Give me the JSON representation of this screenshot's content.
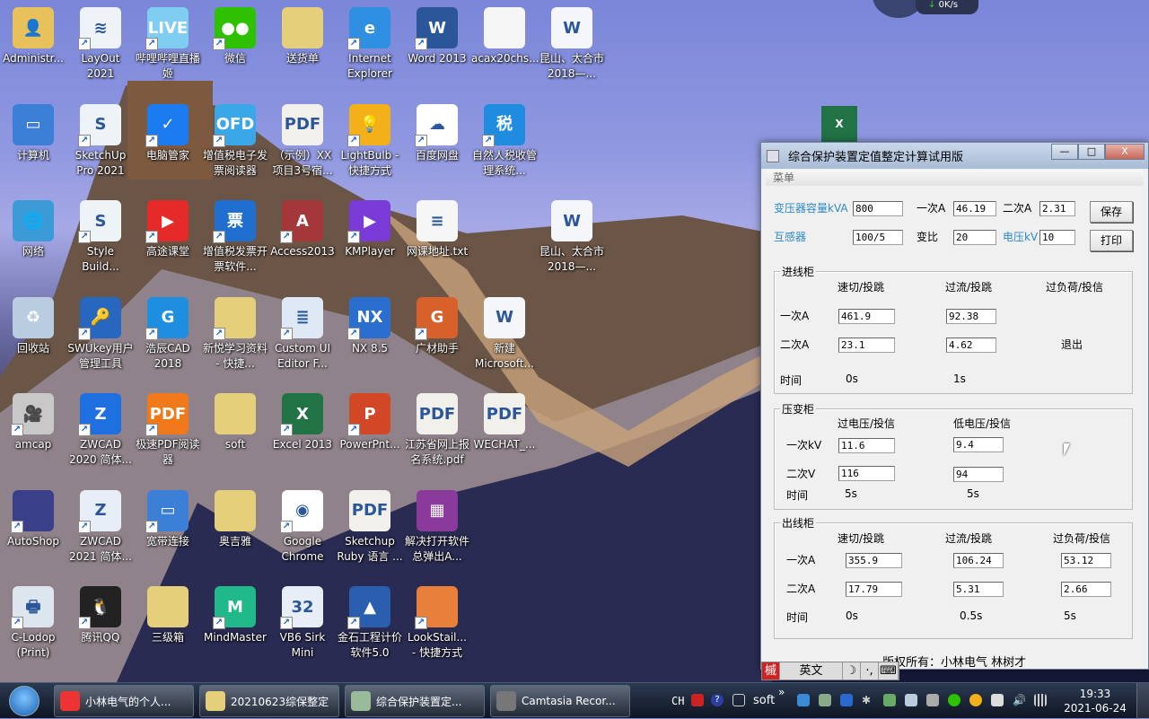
{
  "desktop": {
    "icons": [
      {
        "label": "Administr...",
        "col": 0,
        "row": 0,
        "color": "#e8c15a",
        "glyph": "👤",
        "shortcut": false
      },
      {
        "label": "LayOut 2021",
        "col": 1,
        "row": 0,
        "color": "#eef3f8",
        "glyph": "≋",
        "shortcut": true
      },
      {
        "label": "哔哩哔哩直播姬",
        "col": 2,
        "row": 0,
        "color": "#7fcdf0",
        "glyph": "LIVE",
        "shortcut": true
      },
      {
        "label": "微信",
        "col": 3,
        "row": 0,
        "color": "#2dc100",
        "glyph": "●●",
        "shortcut": true
      },
      {
        "label": "送货单",
        "col": 4,
        "row": 0,
        "color": "#e6cf7a",
        "glyph": "",
        "shortcut": false
      },
      {
        "label": "Internet Explorer",
        "col": 5,
        "row": 0,
        "color": "#2f8fe0",
        "glyph": "e",
        "shortcut": true
      },
      {
        "label": "Word 2013",
        "col": 6,
        "row": 0,
        "color": "#2b579a",
        "glyph": "W",
        "shortcut": true
      },
      {
        "label": "acax20chs...",
        "col": 7,
        "row": 0,
        "color": "#f6f6f6",
        "glyph": "",
        "shortcut": false
      },
      {
        "label": "昆山、太合市2018—...",
        "col": 8,
        "row": 0,
        "color": "#f4f6fa",
        "glyph": "W",
        "shortcut": false
      },
      {
        "label": "计算机",
        "col": 0,
        "row": 1,
        "color": "#3b7fd6",
        "glyph": "▭",
        "shortcut": false
      },
      {
        "label": "SketchUp Pro 2021",
        "col": 1,
        "row": 1,
        "color": "#eef3f8",
        "glyph": "S",
        "shortcut": true
      },
      {
        "label": "电脑管家",
        "col": 2,
        "row": 1,
        "color": "#1a7cf0",
        "glyph": "✓",
        "shortcut": true
      },
      {
        "label": "增值税电子发票阅读器",
        "col": 3,
        "row": 1,
        "color": "#3aa8e8",
        "glyph": "OFD",
        "shortcut": true
      },
      {
        "label": "（示例）XX项目3号宿...",
        "col": 4,
        "row": 1,
        "color": "#f2f0ea",
        "glyph": "PDF",
        "shortcut": false
      },
      {
        "label": "LightBulb - 快捷方式",
        "col": 5,
        "row": 1,
        "color": "#f4b018",
        "glyph": "💡",
        "shortcut": true
      },
      {
        "label": "百度网盘",
        "col": 6,
        "row": 1,
        "color": "#ffffff",
        "glyph": "☁",
        "shortcut": true
      },
      {
        "label": "自然人税收管理系统...",
        "col": 7,
        "row": 1,
        "color": "#1f8ce0",
        "glyph": "税",
        "shortcut": true
      },
      {
        "label": "网络",
        "col": 0,
        "row": 2,
        "color": "#3b9bd6",
        "glyph": "🌐",
        "shortcut": false
      },
      {
        "label": "Style Build...",
        "col": 1,
        "row": 2,
        "color": "#eef3f8",
        "glyph": "S",
        "shortcut": true
      },
      {
        "label": "高途课堂",
        "col": 2,
        "row": 2,
        "color": "#e62a2a",
        "glyph": "▶",
        "shortcut": true
      },
      {
        "label": "增值税发票开票软件...",
        "col": 3,
        "row": 2,
        "color": "#1e6fd0",
        "glyph": "票",
        "shortcut": true
      },
      {
        "label": "Access2013",
        "col": 4,
        "row": 2,
        "color": "#a4373a",
        "glyph": "A",
        "shortcut": true
      },
      {
        "label": "KMPlayer",
        "col": 5,
        "row": 2,
        "color": "#7a3ad8",
        "glyph": "▶",
        "shortcut": true
      },
      {
        "label": "网课地址.txt",
        "col": 6,
        "row": 2,
        "color": "#f6f6f6",
        "glyph": "≡",
        "shortcut": false
      },
      {
        "label": "昆山、太合市2018—...",
        "col": 8,
        "row": 2,
        "color": "#f4f6fa",
        "glyph": "W",
        "shortcut": false
      },
      {
        "label": "回收站",
        "col": 0,
        "row": 3,
        "color": "#b9cce0",
        "glyph": "♻",
        "shortcut": false
      },
      {
        "label": "SWUkey用户管理工具",
        "col": 1,
        "row": 3,
        "color": "#2767c0",
        "glyph": "🔑",
        "shortcut": true
      },
      {
        "label": "浩辰CAD 2018",
        "col": 2,
        "row": 3,
        "color": "#1e8ee0",
        "glyph": "G",
        "shortcut": true
      },
      {
        "label": "新悦学习资料 - 快捷...",
        "col": 3,
        "row": 3,
        "color": "#e6cf7a",
        "glyph": "",
        "shortcut": true
      },
      {
        "label": "Custom UI Editor F...",
        "col": 4,
        "row": 3,
        "color": "#dfe8f5",
        "glyph": "≣",
        "shortcut": true
      },
      {
        "label": "NX 8.5",
        "col": 5,
        "row": 3,
        "color": "#2a6fd0",
        "glyph": "NX",
        "shortcut": true
      },
      {
        "label": "广材助手",
        "col": 6,
        "row": 3,
        "color": "#d8602a",
        "glyph": "G",
        "shortcut": true
      },
      {
        "label": "新建 Microsoft...",
        "col": 7,
        "row": 3,
        "color": "#f4f6fa",
        "glyph": "W",
        "shortcut": false
      },
      {
        "label": "amcap",
        "col": 0,
        "row": 4,
        "color": "#c8c8c8",
        "glyph": "🎥",
        "shortcut": true
      },
      {
        "label": "ZWCAD 2020 简体...",
        "col": 1,
        "row": 4,
        "color": "#1e6fe0",
        "glyph": "Z",
        "shortcut": true
      },
      {
        "label": "极速PDF阅读器",
        "col": 2,
        "row": 4,
        "color": "#f07a1a",
        "glyph": "PDF",
        "shortcut": true
      },
      {
        "label": "soft",
        "col": 3,
        "row": 4,
        "color": "#e6cf7a",
        "glyph": "",
        "shortcut": false
      },
      {
        "label": "Excel 2013",
        "col": 4,
        "row": 4,
        "color": "#217346",
        "glyph": "X",
        "shortcut": true
      },
      {
        "label": "PowerPnt...",
        "col": 5,
        "row": 4,
        "color": "#d24726",
        "glyph": "P",
        "shortcut": true
      },
      {
        "label": "江苏省网上报名系统.pdf",
        "col": 6,
        "row": 4,
        "color": "#f2f0ea",
        "glyph": "PDF",
        "shortcut": false
      },
      {
        "label": "WECHAT_...",
        "col": 7,
        "row": 4,
        "color": "#f2f0ea",
        "glyph": "PDF",
        "shortcut": false
      },
      {
        "label": "AutoShop",
        "col": 0,
        "row": 5,
        "color": "#3a3f8a",
        "glyph": "",
        "shortcut": true
      },
      {
        "label": "ZWCAD 2021 简体...",
        "col": 1,
        "row": 5,
        "color": "#e8eef8",
        "glyph": "Z",
        "shortcut": true
      },
      {
        "label": "宽带连接",
        "col": 2,
        "row": 5,
        "color": "#3b7fd6",
        "glyph": "▭",
        "shortcut": true
      },
      {
        "label": "奥吉雅",
        "col": 3,
        "row": 5,
        "color": "#e6cf7a",
        "glyph": "",
        "shortcut": false
      },
      {
        "label": "Google Chrome",
        "col": 4,
        "row": 5,
        "color": "#ffffff",
        "glyph": "◉",
        "shortcut": true
      },
      {
        "label": "Sketchup Ruby 语言 ...",
        "col": 5,
        "row": 5,
        "color": "#f2f0ea",
        "glyph": "PDF",
        "shortcut": false
      },
      {
        "label": "解决打开软件总弹出A...",
        "col": 6,
        "row": 5,
        "color": "#8a3a9a",
        "glyph": "▦",
        "shortcut": false
      },
      {
        "label": "C-Lodop (Print)",
        "col": 0,
        "row": 6,
        "color": "#dde6ee",
        "glyph": "🖶",
        "shortcut": true
      },
      {
        "label": "腾讯QQ",
        "col": 1,
        "row": 6,
        "color": "#222222",
        "glyph": "🐧",
        "shortcut": true
      },
      {
        "label": "三级箱",
        "col": 2,
        "row": 6,
        "color": "#e6cf7a",
        "glyph": "",
        "shortcut": false
      },
      {
        "label": "MindMaster",
        "col": 3,
        "row": 6,
        "color": "#1fb98a",
        "glyph": "M",
        "shortcut": true
      },
      {
        "label": "VB6 Sirk Mini",
        "col": 4,
        "row": 6,
        "color": "#e8eef8",
        "glyph": "32",
        "shortcut": true
      },
      {
        "label": "金石工程计价软件5.0",
        "col": 5,
        "row": 6,
        "color": "#2a5fb0",
        "glyph": "▲",
        "shortcut": true
      },
      {
        "label": "LookStail... - 快捷方式",
        "col": 6,
        "row": 6,
        "color": "#e8803a",
        "glyph": "",
        "shortcut": true
      }
    ],
    "net_widget": {
      "speed": "0K/s"
    }
  },
  "window": {
    "title": "综合保护装置定值整定计算试用版",
    "controls": {
      "minimize": "—",
      "maximize": "□",
      "close": "X"
    },
    "menu": "菜单",
    "top": {
      "capacity_label": "变压器容量kVA",
      "capacity": "800",
      "primary_label": "一次A",
      "primary": "46.19",
      "secondary_label": "二次A",
      "secondary": "2.31",
      "ct_label": "互感器",
      "ct": "100/5",
      "ratio_label": "变比",
      "ratio": "20",
      "voltage_label": "电压kV",
      "voltage": "10",
      "save": "保存",
      "print": "打印"
    },
    "incoming": {
      "title": "进线柜",
      "h1": "速切/投跳",
      "h2": "过流/投跳",
      "h3": "过负荷/投信",
      "primary_label": "一次A",
      "secondary_label": "二次A",
      "time_label": "时间",
      "quick_primary": "461.9",
      "quick_secondary": "23.1",
      "quick_time": "0s",
      "over_primary": "92.38",
      "over_secondary": "4.62",
      "over_time": "1s",
      "overload_state": "退出"
    },
    "pt": {
      "title": "压变柜",
      "h1": "过电压/投信",
      "h2": "低电压/投信",
      "primary_label": "一次kV",
      "secondary_label": "二次V",
      "time_label": "时间",
      "ov_primary": "11.6",
      "ov_secondary": "116",
      "ov_time": "5s",
      "uv_primary": "9.4",
      "uv_secondary": "94",
      "uv_time": "5s"
    },
    "outgoing": {
      "title": "出线柜",
      "h1": "速切/投跳",
      "h2": "过流/投跳",
      "h3": "过负荷/投信",
      "primary_label": "一次A",
      "secondary_label": "二次A",
      "time_label": "时间",
      "quick_primary": "355.9",
      "quick_secondary": "17.79",
      "quick_time": "0s",
      "over_primary": "106.24",
      "over_secondary": "5.31",
      "over_time": "0.5s",
      "ol_primary": "53.12",
      "ol_secondary": "2.66",
      "ol_time": "5s"
    },
    "copyright": "版权所有：小林电气 林树才"
  },
  "ime": {
    "logo": "槭",
    "mode": "英文",
    "moon": "☽",
    "punct": "·,",
    "keyboard": "⌨"
  },
  "taskbar": {
    "items": [
      {
        "label": "小林电气的个人...",
        "icon": "chrome-icon"
      },
      {
        "label": "20210623综保整定",
        "icon": "folder-icon"
      },
      {
        "label": "综合保护装置定...",
        "icon": "app-icon"
      },
      {
        "label": "Camtasia Recor...",
        "icon": "camtasia-icon"
      }
    ],
    "lang": "CH",
    "toolbar": "soft",
    "chevron": "»",
    "time": "19:33",
    "date": "2021-06-24"
  }
}
